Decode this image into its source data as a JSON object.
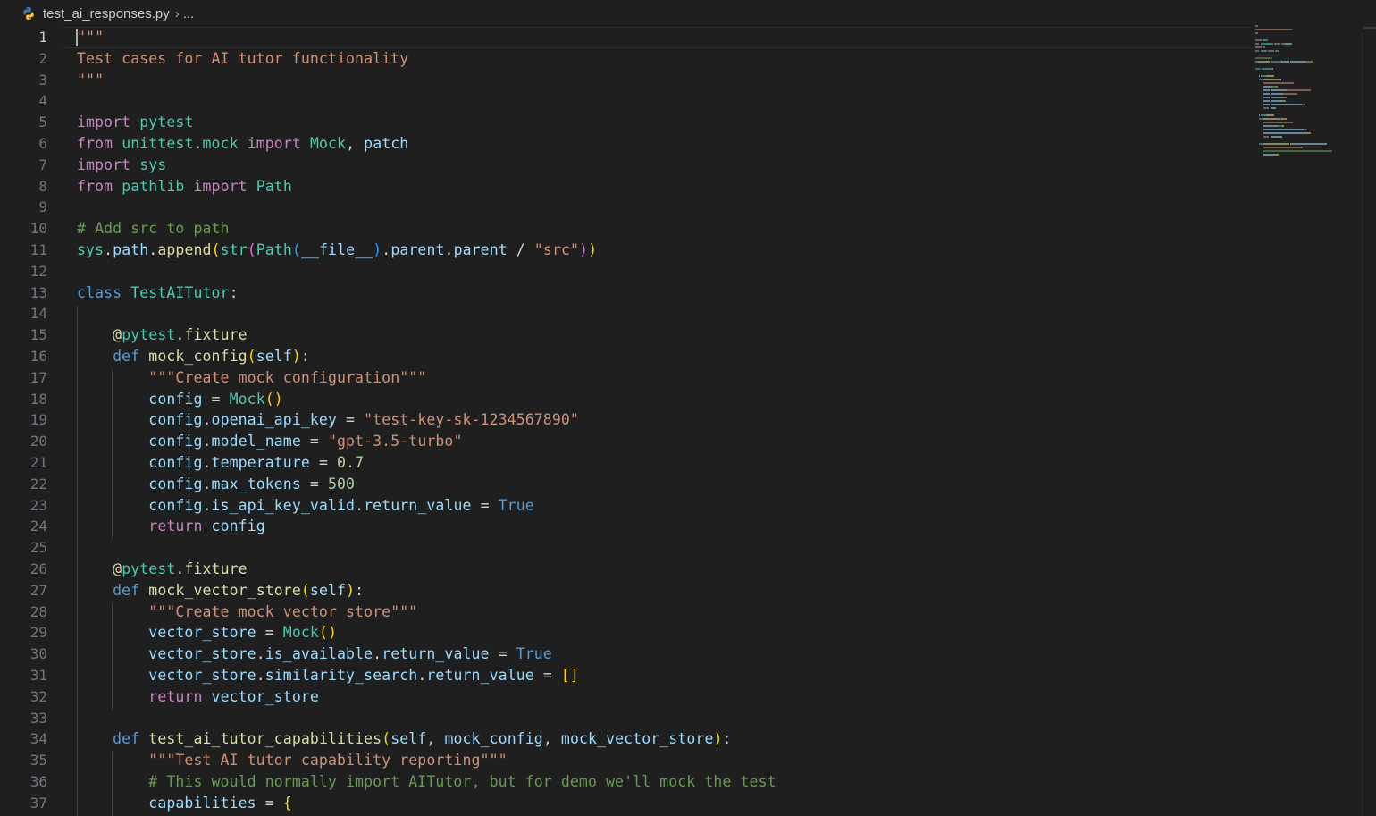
{
  "breadcrumb": {
    "file": "test_ai_responses.py",
    "more": "..."
  },
  "editor": {
    "active_line": 1,
    "lines": [
      {
        "n": "1",
        "t": [
          [
            "str",
            "\"\"\""
          ]
        ]
      },
      {
        "n": "2",
        "t": [
          [
            "str",
            "Test cases for AI tutor functionality"
          ]
        ]
      },
      {
        "n": "3",
        "t": [
          [
            "str",
            "\"\"\""
          ]
        ]
      },
      {
        "n": "4",
        "t": []
      },
      {
        "n": "5",
        "t": [
          [
            "kw",
            "import"
          ],
          [
            "op",
            " "
          ],
          [
            "cl",
            "pytest"
          ]
        ]
      },
      {
        "n": "6",
        "t": [
          [
            "kw",
            "from"
          ],
          [
            "op",
            " "
          ],
          [
            "cl",
            "unittest"
          ],
          [
            "op",
            "."
          ],
          [
            "cl",
            "mock"
          ],
          [
            "op",
            " "
          ],
          [
            "kw",
            "import"
          ],
          [
            "op",
            " "
          ],
          [
            "cl",
            "Mock"
          ],
          [
            "op",
            ", "
          ],
          [
            "var",
            "patch"
          ]
        ]
      },
      {
        "n": "7",
        "t": [
          [
            "kw",
            "import"
          ],
          [
            "op",
            " "
          ],
          [
            "cl",
            "sys"
          ]
        ]
      },
      {
        "n": "8",
        "t": [
          [
            "kw",
            "from"
          ],
          [
            "op",
            " "
          ],
          [
            "cl",
            "pathlib"
          ],
          [
            "op",
            " "
          ],
          [
            "kw",
            "import"
          ],
          [
            "op",
            " "
          ],
          [
            "cl",
            "Path"
          ]
        ]
      },
      {
        "n": "9",
        "t": []
      },
      {
        "n": "10",
        "t": [
          [
            "cm",
            "# Add src to path"
          ]
        ]
      },
      {
        "n": "11",
        "t": [
          [
            "cl",
            "sys"
          ],
          [
            "op",
            "."
          ],
          [
            "var",
            "path"
          ],
          [
            "op",
            "."
          ],
          [
            "fn",
            "append"
          ],
          [
            "by",
            "("
          ],
          [
            "cl",
            "str"
          ],
          [
            "bp",
            "("
          ],
          [
            "cl",
            "Path"
          ],
          [
            "bb",
            "("
          ],
          [
            "var",
            "__file__"
          ],
          [
            "bb",
            ")"
          ],
          [
            "op",
            "."
          ],
          [
            "var",
            "parent"
          ],
          [
            "op",
            "."
          ],
          [
            "var",
            "parent"
          ],
          [
            "op",
            " / "
          ],
          [
            "str",
            "\"src\""
          ],
          [
            "bp",
            ")"
          ],
          [
            "by",
            ")"
          ]
        ]
      },
      {
        "n": "12",
        "t": []
      },
      {
        "n": "13",
        "t": [
          [
            "kb",
            "class"
          ],
          [
            "op",
            " "
          ],
          [
            "cl",
            "TestAITutor"
          ],
          [
            "op",
            ":"
          ]
        ]
      },
      {
        "n": "14",
        "t": []
      },
      {
        "n": "15",
        "t": [
          [
            "op",
            "    "
          ],
          [
            "fn",
            "@"
          ],
          [
            "cl",
            "pytest"
          ],
          [
            "op",
            "."
          ],
          [
            "fn",
            "fixture"
          ]
        ]
      },
      {
        "n": "16",
        "t": [
          [
            "op",
            "    "
          ],
          [
            "kb",
            "def"
          ],
          [
            "op",
            " "
          ],
          [
            "fn",
            "mock_config"
          ],
          [
            "by",
            "("
          ],
          [
            "var",
            "self"
          ],
          [
            "by",
            ")"
          ],
          [
            "op",
            ":"
          ]
        ]
      },
      {
        "n": "17",
        "t": [
          [
            "op",
            "        "
          ],
          [
            "str",
            "\"\"\"Create mock configuration\"\"\""
          ]
        ]
      },
      {
        "n": "18",
        "t": [
          [
            "op",
            "        "
          ],
          [
            "var",
            "config"
          ],
          [
            "op",
            " = "
          ],
          [
            "cl",
            "Mock"
          ],
          [
            "by",
            "()"
          ]
        ]
      },
      {
        "n": "19",
        "t": [
          [
            "op",
            "        "
          ],
          [
            "var",
            "config"
          ],
          [
            "op",
            "."
          ],
          [
            "var",
            "openai_api_key"
          ],
          [
            "op",
            " = "
          ],
          [
            "str",
            "\"test-key-sk-1234567890\""
          ]
        ]
      },
      {
        "n": "20",
        "t": [
          [
            "op",
            "        "
          ],
          [
            "var",
            "config"
          ],
          [
            "op",
            "."
          ],
          [
            "var",
            "model_name"
          ],
          [
            "op",
            " = "
          ],
          [
            "str",
            "\"gpt-3.5-turbo\""
          ]
        ]
      },
      {
        "n": "21",
        "t": [
          [
            "op",
            "        "
          ],
          [
            "var",
            "config"
          ],
          [
            "op",
            "."
          ],
          [
            "var",
            "temperature"
          ],
          [
            "op",
            " = "
          ],
          [
            "num",
            "0.7"
          ]
        ]
      },
      {
        "n": "22",
        "t": [
          [
            "op",
            "        "
          ],
          [
            "var",
            "config"
          ],
          [
            "op",
            "."
          ],
          [
            "var",
            "max_tokens"
          ],
          [
            "op",
            " = "
          ],
          [
            "num",
            "500"
          ]
        ]
      },
      {
        "n": "23",
        "t": [
          [
            "op",
            "        "
          ],
          [
            "var",
            "config"
          ],
          [
            "op",
            "."
          ],
          [
            "var",
            "is_api_key_valid"
          ],
          [
            "op",
            "."
          ],
          [
            "var",
            "return_value"
          ],
          [
            "op",
            " = "
          ],
          [
            "kb",
            "True"
          ]
        ]
      },
      {
        "n": "24",
        "t": [
          [
            "op",
            "        "
          ],
          [
            "kw",
            "return"
          ],
          [
            "op",
            " "
          ],
          [
            "var",
            "config"
          ]
        ]
      },
      {
        "n": "25",
        "t": []
      },
      {
        "n": "26",
        "t": [
          [
            "op",
            "    "
          ],
          [
            "fn",
            "@"
          ],
          [
            "cl",
            "pytest"
          ],
          [
            "op",
            "."
          ],
          [
            "fn",
            "fixture"
          ]
        ]
      },
      {
        "n": "27",
        "t": [
          [
            "op",
            "    "
          ],
          [
            "kb",
            "def"
          ],
          [
            "op",
            " "
          ],
          [
            "fn",
            "mock_vector_store"
          ],
          [
            "by",
            "("
          ],
          [
            "var",
            "self"
          ],
          [
            "by",
            ")"
          ],
          [
            "op",
            ":"
          ]
        ]
      },
      {
        "n": "28",
        "t": [
          [
            "op",
            "        "
          ],
          [
            "str",
            "\"\"\"Create mock vector store\"\"\""
          ]
        ]
      },
      {
        "n": "29",
        "t": [
          [
            "op",
            "        "
          ],
          [
            "var",
            "vector_store"
          ],
          [
            "op",
            " = "
          ],
          [
            "cl",
            "Mock"
          ],
          [
            "by",
            "()"
          ]
        ]
      },
      {
        "n": "30",
        "t": [
          [
            "op",
            "        "
          ],
          [
            "var",
            "vector_store"
          ],
          [
            "op",
            "."
          ],
          [
            "var",
            "is_available"
          ],
          [
            "op",
            "."
          ],
          [
            "var",
            "return_value"
          ],
          [
            "op",
            " = "
          ],
          [
            "kb",
            "True"
          ]
        ]
      },
      {
        "n": "31",
        "t": [
          [
            "op",
            "        "
          ],
          [
            "var",
            "vector_store"
          ],
          [
            "op",
            "."
          ],
          [
            "var",
            "similarity_search"
          ],
          [
            "op",
            "."
          ],
          [
            "var",
            "return_value"
          ],
          [
            "op",
            " = "
          ],
          [
            "by",
            "[]"
          ]
        ]
      },
      {
        "n": "32",
        "t": [
          [
            "op",
            "        "
          ],
          [
            "kw",
            "return"
          ],
          [
            "op",
            " "
          ],
          [
            "var",
            "vector_store"
          ]
        ]
      },
      {
        "n": "33",
        "t": []
      },
      {
        "n": "34",
        "t": [
          [
            "op",
            "    "
          ],
          [
            "kb",
            "def"
          ],
          [
            "op",
            " "
          ],
          [
            "fn",
            "test_ai_tutor_capabilities"
          ],
          [
            "by",
            "("
          ],
          [
            "var",
            "self"
          ],
          [
            "op",
            ", "
          ],
          [
            "var",
            "mock_config"
          ],
          [
            "op",
            ", "
          ],
          [
            "var",
            "mock_vector_store"
          ],
          [
            "by",
            ")"
          ],
          [
            "op",
            ":"
          ]
        ]
      },
      {
        "n": "35",
        "t": [
          [
            "op",
            "        "
          ],
          [
            "str",
            "\"\"\"Test AI tutor capability reporting\"\"\""
          ]
        ]
      },
      {
        "n": "36",
        "t": [
          [
            "op",
            "        "
          ],
          [
            "cm",
            "# This would normally import AITutor, but for demo we'll mock the test"
          ]
        ]
      },
      {
        "n": "37",
        "t": [
          [
            "op",
            "        "
          ],
          [
            "var",
            "capabilities"
          ],
          [
            "op",
            " = "
          ],
          [
            "by",
            "{"
          ]
        ]
      }
    ]
  },
  "colors": {
    "background": "#1f1f1f",
    "keyword": "#c586c0",
    "storage": "#569cd6",
    "string": "#ce9178",
    "comment": "#6a9955",
    "function": "#dcdcaa",
    "class": "#4ec9b0",
    "variable": "#9cdcfe",
    "number": "#b5cea8"
  },
  "icons": {
    "file_type": "python-file-icon",
    "separator": "chevron-right-icon"
  }
}
